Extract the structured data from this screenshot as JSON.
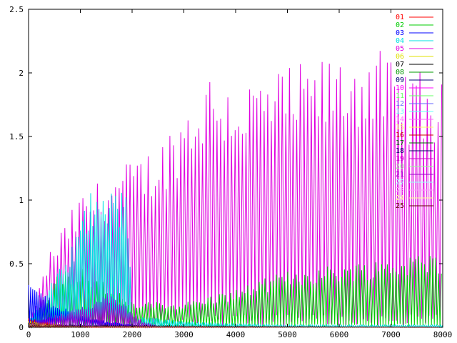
{
  "chart_data": {
    "type": "line",
    "title": "",
    "xlabel": "",
    "ylabel": "",
    "xlim": [
      0,
      8000
    ],
    "ylim": [
      0,
      2.5
    ],
    "x_ticks": [
      "0",
      "1000",
      "2000",
      "3000",
      "4000",
      "5000",
      "6000",
      "7000",
      "8000"
    ],
    "y_ticks": [
      "0",
      "0.5",
      "1",
      "1.5",
      "2",
      "2.5"
    ],
    "grid": false,
    "legend_position": "top-right",
    "series": [
      {
        "name": "01",
        "color": "#ff0000",
        "profile": [
          [
            0,
            0.08
          ],
          [
            200,
            0.05
          ],
          [
            600,
            0.02
          ],
          [
            1200,
            0.0
          ],
          [
            8000,
            0.0
          ]
        ]
      },
      {
        "name": "02",
        "color": "#00cc00",
        "profile": [
          [
            0,
            0.05
          ],
          [
            300,
            0.2
          ],
          [
            600,
            0.45
          ],
          [
            1000,
            0.5
          ],
          [
            1500,
            0.35
          ],
          [
            2000,
            0.2
          ],
          [
            3000,
            0.2
          ],
          [
            4000,
            0.3
          ],
          [
            5000,
            0.45
          ],
          [
            6000,
            0.5
          ],
          [
            7000,
            0.55
          ],
          [
            8000,
            0.6
          ]
        ]
      },
      {
        "name": "03",
        "color": "#0000ff",
        "profile": [
          [
            0,
            0.35
          ],
          [
            200,
            0.3
          ],
          [
            500,
            0.2
          ],
          [
            900,
            0.12
          ],
          [
            1500,
            0.05
          ],
          [
            2000,
            0.02
          ],
          [
            2500,
            0.0
          ],
          [
            8000,
            0.0
          ]
        ]
      },
      {
        "name": "04",
        "color": "#00e0e0",
        "profile": [
          [
            0,
            0.05
          ],
          [
            800,
            0.6
          ],
          [
            1300,
            1.2
          ],
          [
            1700,
            1.1
          ],
          [
            1900,
            1.05
          ],
          [
            2000,
            0.1
          ],
          [
            3000,
            0.05
          ],
          [
            4000,
            0.03
          ],
          [
            5000,
            0.02
          ],
          [
            8000,
            0.02
          ]
        ]
      },
      {
        "name": "05",
        "color": "#e000e0",
        "profile": [
          [
            0,
            0.02
          ],
          [
            400,
            0.6
          ],
          [
            1000,
            1.05
          ],
          [
            1500,
            1.2
          ],
          [
            2500,
            1.45
          ],
          [
            3000,
            1.75
          ],
          [
            3500,
            2.05
          ],
          [
            4000,
            1.95
          ],
          [
            5000,
            2.05
          ],
          [
            6000,
            2.15
          ],
          [
            6600,
            2.25
          ],
          [
            7000,
            2.1
          ],
          [
            8000,
            1.95
          ]
        ]
      },
      {
        "name": "06",
        "color": "#e0e000",
        "profile": [
          [
            0,
            0.06
          ],
          [
            300,
            0.03
          ],
          [
            800,
            0.01
          ],
          [
            8000,
            0.0
          ]
        ]
      },
      {
        "name": "07",
        "color": "#000000",
        "profile": [
          [
            0,
            0.04
          ],
          [
            300,
            0.02
          ],
          [
            8000,
            0.0
          ]
        ]
      },
      {
        "name": "08",
        "color": "#009900",
        "profile": [
          [
            0,
            0.03
          ],
          [
            500,
            0.01
          ],
          [
            8000,
            0.0
          ]
        ]
      },
      {
        "name": "09",
        "color": "#000077",
        "profile": [
          [
            0,
            0.03
          ],
          [
            500,
            0.01
          ],
          [
            8000,
            0.0
          ]
        ]
      },
      {
        "name": "10",
        "color": "#ff00ff",
        "profile": [
          [
            0,
            0.03
          ],
          [
            500,
            0.01
          ],
          [
            8000,
            0.0
          ]
        ]
      },
      {
        "name": "11",
        "color": "#66ff66",
        "profile": [
          [
            0,
            0.02
          ],
          [
            500,
            0.01
          ],
          [
            8000,
            0.0
          ]
        ]
      },
      {
        "name": "12",
        "color": "#6666ff",
        "profile": [
          [
            0,
            0.02
          ],
          [
            500,
            0.01
          ],
          [
            8000,
            0.0
          ]
        ]
      },
      {
        "name": "13",
        "color": "#66ffff",
        "profile": [
          [
            0,
            0.02
          ],
          [
            500,
            0.01
          ],
          [
            8000,
            0.0
          ]
        ]
      },
      {
        "name": "14",
        "color": "#ff66ff",
        "profile": [
          [
            0,
            0.02
          ],
          [
            500,
            0.01
          ],
          [
            8000,
            0.0
          ]
        ]
      },
      {
        "name": "15",
        "color": "#ffff66",
        "profile": [
          [
            0,
            0.02
          ],
          [
            500,
            0.01
          ],
          [
            8000,
            0.0
          ]
        ]
      },
      {
        "name": "16",
        "color": "#cc0000",
        "profile": [
          [
            0,
            0.02
          ],
          [
            500,
            0.01
          ],
          [
            8000,
            0.0
          ]
        ]
      },
      {
        "name": "17",
        "color": "#006600",
        "profile": [
          [
            0,
            0.02
          ],
          [
            500,
            0.01
          ],
          [
            8000,
            0.0
          ]
        ]
      },
      {
        "name": "18",
        "color": "#000066",
        "profile": [
          [
            0,
            0.02
          ],
          [
            500,
            0.01
          ],
          [
            8000,
            0.0
          ]
        ]
      },
      {
        "name": "19",
        "color": "#cc00cc",
        "profile": [
          [
            0,
            0.02
          ],
          [
            500,
            0.01
          ],
          [
            8000,
            0.0
          ]
        ]
      },
      {
        "name": "20",
        "color": "#99ff99",
        "profile": [
          [
            0,
            0.02
          ],
          [
            500,
            0.01
          ],
          [
            8000,
            0.0
          ]
        ]
      },
      {
        "name": "21",
        "color": "#9900cc",
        "profile": [
          [
            0,
            0.05
          ],
          [
            1000,
            0.15
          ],
          [
            1500,
            0.28
          ],
          [
            1800,
            0.2
          ],
          [
            2200,
            0.05
          ],
          [
            2600,
            0.0
          ],
          [
            8000,
            0.0
          ]
        ]
      },
      {
        "name": "22",
        "color": "#99ffff",
        "profile": [
          [
            0,
            0.02
          ],
          [
            500,
            0.01
          ],
          [
            8000,
            0.0
          ]
        ]
      },
      {
        "name": "23",
        "color": "#ff99ff",
        "profile": [
          [
            0,
            0.02
          ],
          [
            500,
            0.01
          ],
          [
            8000,
            0.0
          ]
        ]
      },
      {
        "name": "24",
        "color": "#ffff99",
        "profile": [
          [
            0,
            0.02
          ],
          [
            500,
            0.01
          ],
          [
            8000,
            0.0
          ]
        ]
      },
      {
        "name": "25",
        "color": "#660000",
        "profile": [
          [
            0,
            0.02
          ],
          [
            500,
            0.01
          ],
          [
            8000,
            0.0
          ]
        ]
      }
    ]
  }
}
